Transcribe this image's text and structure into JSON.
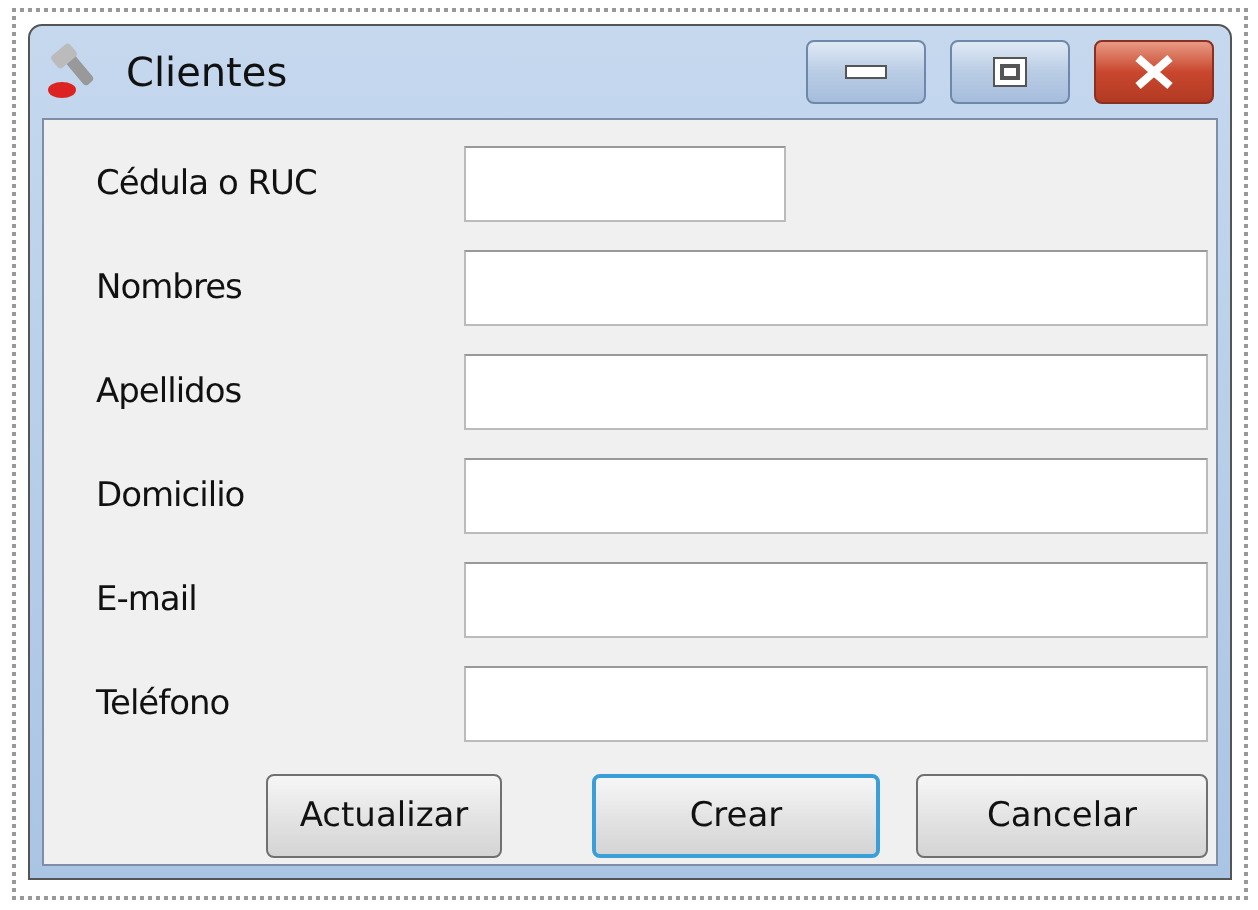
{
  "window": {
    "title": "Clientes"
  },
  "fields": [
    {
      "label": "Cédula o RUC",
      "kind": "short"
    },
    {
      "label": "Nombres",
      "kind": "long"
    },
    {
      "label": "Apellidos",
      "kind": "long"
    },
    {
      "label": "Domicilio",
      "kind": "long"
    },
    {
      "label": "E-mail",
      "kind": "long"
    },
    {
      "label": "Teléfono",
      "kind": "long"
    }
  ],
  "buttons": [
    {
      "label": "Actualizar",
      "default": false
    },
    {
      "label": "Crear",
      "default": true
    },
    {
      "label": "Cancelar",
      "default": false
    }
  ]
}
